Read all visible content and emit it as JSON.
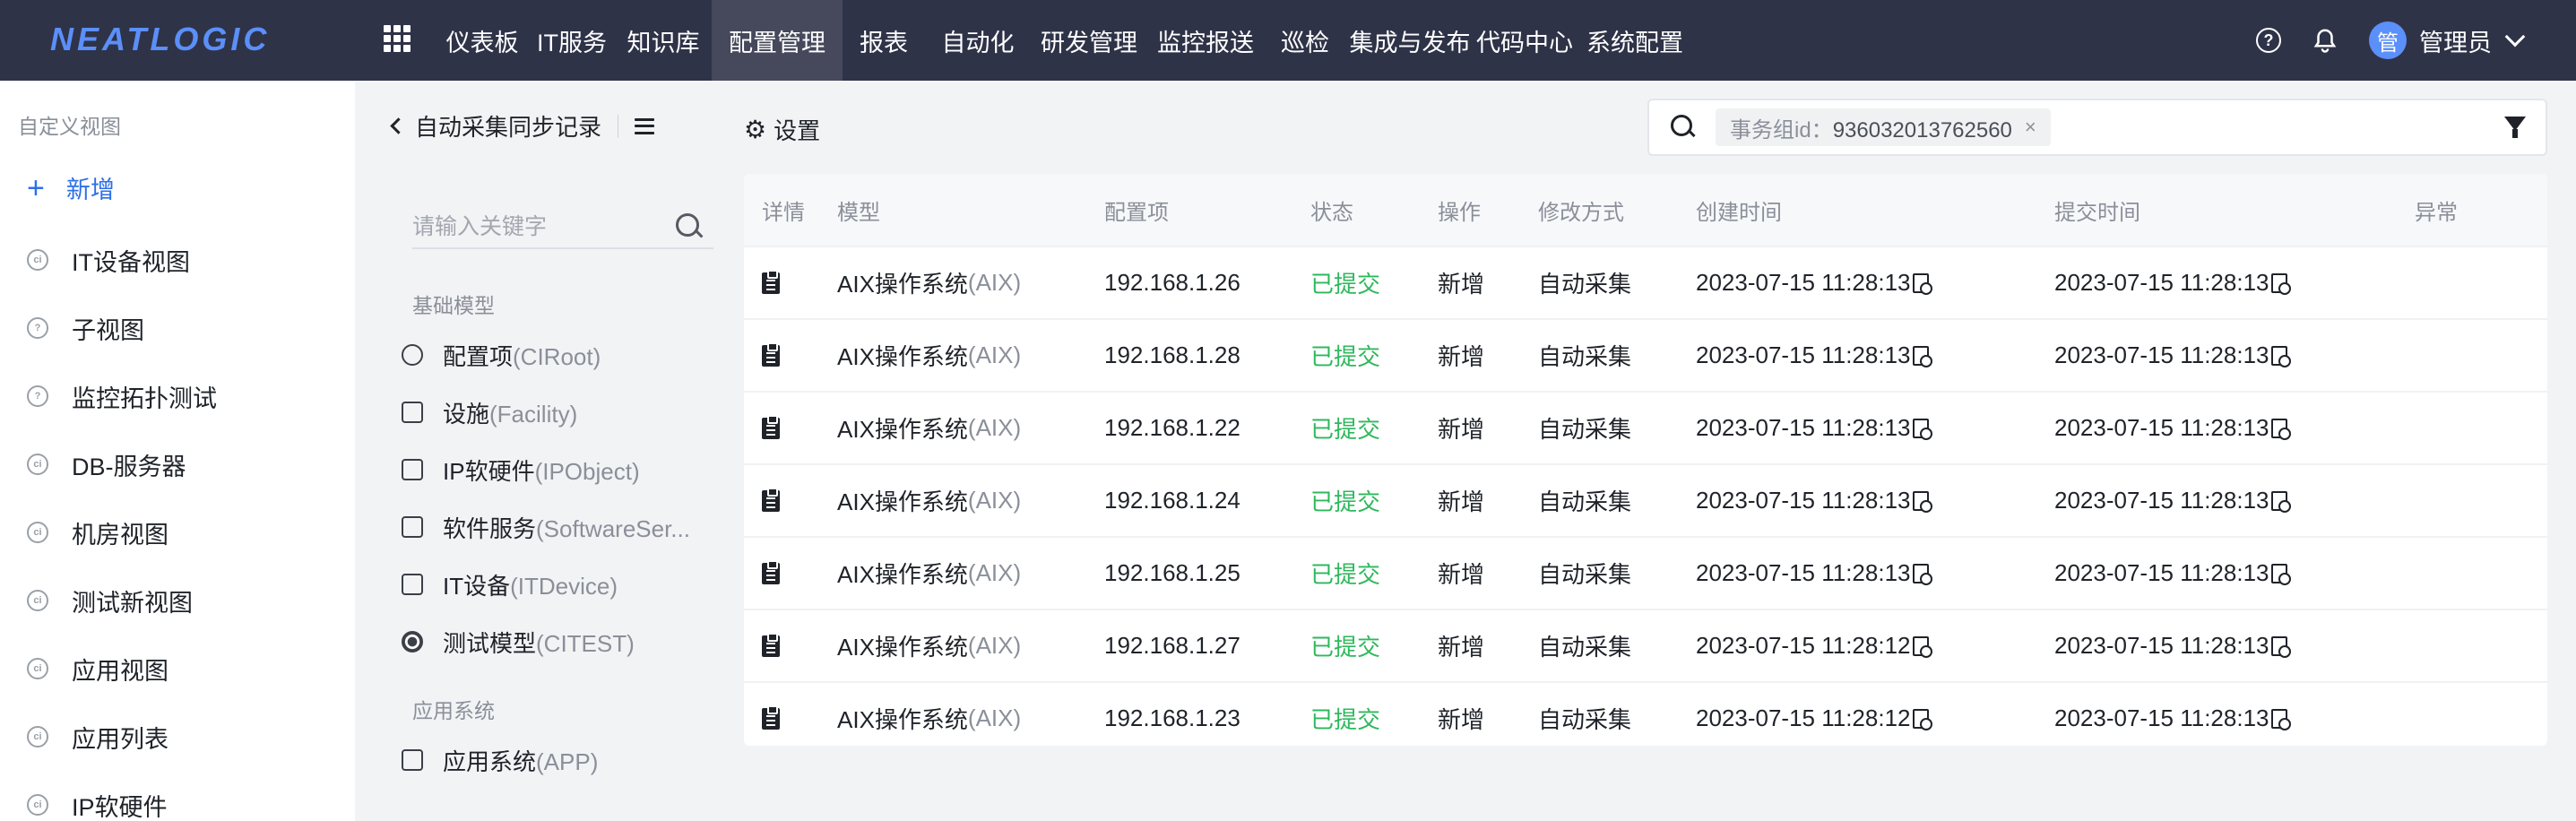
{
  "app": {
    "logo_text": "NEATLOGIC"
  },
  "nav": {
    "items": [
      "仪表板",
      "IT服务",
      "知识库",
      "配置管理",
      "报表",
      "自动化",
      "研发管理",
      "监控报送",
      "巡检",
      "集成与发布",
      "代码中心",
      "系统配置"
    ],
    "active": "配置管理"
  },
  "topbar": {
    "help_symbol": "?",
    "avatar_char": "管",
    "user_name": "管理员"
  },
  "sidebar": {
    "title": "自定义视图",
    "add_label": "新增",
    "items": [
      {
        "label": "IT设备视图",
        "icon": "ci-icon"
      },
      {
        "label": "子视图",
        "icon": "help-icon"
      },
      {
        "label": "监控拓扑测试",
        "icon": "help-icon"
      },
      {
        "label": "DB-服务器",
        "icon": "ci-icon"
      },
      {
        "label": "机房视图",
        "icon": "ci-icon"
      },
      {
        "label": "测试新视图",
        "icon": "ci-icon"
      },
      {
        "label": "应用视图",
        "icon": "ci-icon"
      },
      {
        "label": "应用列表",
        "icon": "ci-icon"
      },
      {
        "label": "IP软硬件",
        "icon": "ci-icon"
      }
    ]
  },
  "midpanel": {
    "back_title": "自动采集同步记录",
    "search_placeholder": "请输入关键字",
    "group1_title": "基础模型",
    "group1_items": [
      {
        "name": "配置项",
        "code": "(CIRoot)"
      },
      {
        "name": "设施",
        "code": "(Facility)"
      },
      {
        "name": "IP软硬件",
        "code": "(IPObject)"
      },
      {
        "name": "软件服务",
        "code": "(SoftwareSer..."
      },
      {
        "name": "IT设备",
        "code": "(ITDevice)"
      },
      {
        "name": "测试模型",
        "code": "(CITEST)"
      }
    ],
    "group2_title": "应用系统",
    "group2_items": [
      {
        "name": "应用系统",
        "code": "(APP)"
      }
    ]
  },
  "main": {
    "settings_label": "设置",
    "filter_tag_key": "事务组id：",
    "filter_tag_value": "936032013762560",
    "filter_tag_close": "×"
  },
  "table": {
    "headers": [
      "详情",
      "模型",
      "配置项",
      "状态",
      "操作",
      "修改方式",
      "创建时间",
      "提交时间",
      "异常"
    ],
    "rows": [
      {
        "model": "AIX操作系统",
        "model_code": "(AIX)",
        "ci": "192.168.1.26",
        "status": "已提交",
        "action": "新增",
        "method": "自动采集",
        "created": "2023-07-15 11:28:13",
        "submitted": "2023-07-15 11:28:13",
        "error": ""
      },
      {
        "model": "AIX操作系统",
        "model_code": "(AIX)",
        "ci": "192.168.1.28",
        "status": "已提交",
        "action": "新增",
        "method": "自动采集",
        "created": "2023-07-15 11:28:13",
        "submitted": "2023-07-15 11:28:13",
        "error": ""
      },
      {
        "model": "AIX操作系统",
        "model_code": "(AIX)",
        "ci": "192.168.1.22",
        "status": "已提交",
        "action": "新增",
        "method": "自动采集",
        "created": "2023-07-15 11:28:13",
        "submitted": "2023-07-15 11:28:13",
        "error": ""
      },
      {
        "model": "AIX操作系统",
        "model_code": "(AIX)",
        "ci": "192.168.1.24",
        "status": "已提交",
        "action": "新增",
        "method": "自动采集",
        "created": "2023-07-15 11:28:13",
        "submitted": "2023-07-15 11:28:13",
        "error": ""
      },
      {
        "model": "AIX操作系统",
        "model_code": "(AIX)",
        "ci": "192.168.1.25",
        "status": "已提交",
        "action": "新增",
        "method": "自动采集",
        "created": "2023-07-15 11:28:13",
        "submitted": "2023-07-15 11:28:13",
        "error": ""
      },
      {
        "model": "AIX操作系统",
        "model_code": "(AIX)",
        "ci": "192.168.1.27",
        "status": "已提交",
        "action": "新增",
        "method": "自动采集",
        "created": "2023-07-15 11:28:12",
        "submitted": "2023-07-15 11:28:13",
        "error": ""
      },
      {
        "model": "AIX操作系统",
        "model_code": "(AIX)",
        "ci": "192.168.1.23",
        "status": "已提交",
        "action": "新增",
        "method": "自动采集",
        "created": "2023-07-15 11:28:12",
        "submitted": "2023-07-15 11:28:13",
        "error": ""
      }
    ]
  },
  "colors": {
    "topbar_bg": "#2f3348",
    "nav_active_bg": "#46495c",
    "accent": "#2d6fe8",
    "status_ok": "#2eb85c",
    "logo": "#5b8ff9"
  }
}
